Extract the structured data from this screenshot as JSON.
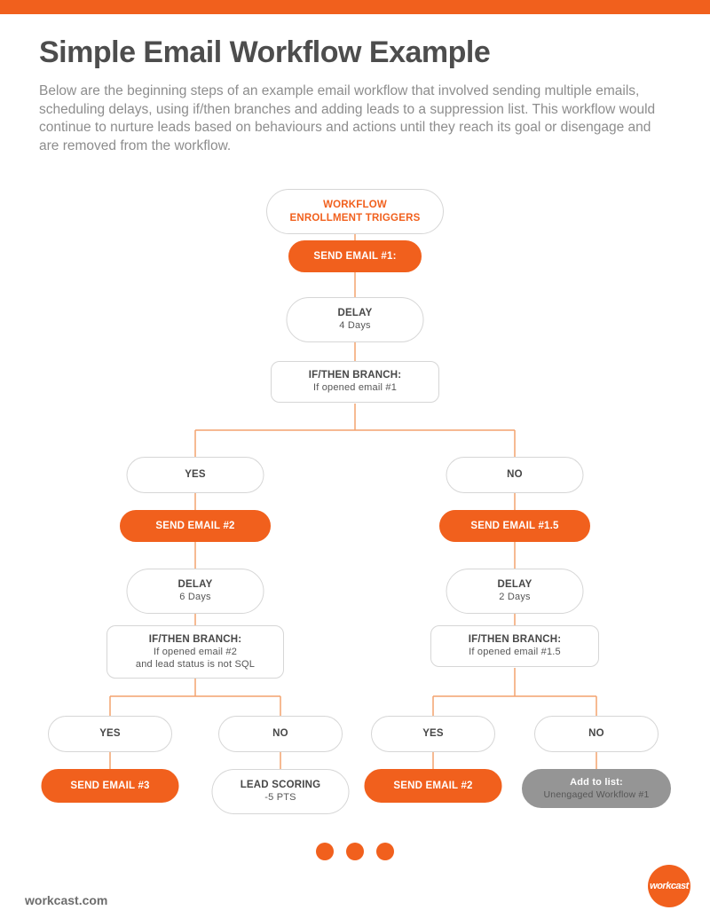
{
  "colors": {
    "accent": "#f1601d",
    "grey": "#959595"
  },
  "header": {
    "title": "Simple Email Workflow Example",
    "intro": "Below are the beginning steps of an example email workflow that involved sending multiple emails, scheduling delays, using if/then branches and adding leads to a suppression list. This workflow would continue to nurture leads based on behaviours and actions until they reach its goal or disengage and are removed from the workflow."
  },
  "nodes": {
    "enroll_l1": "WORKFLOW",
    "enroll_l2": "ENROLLMENT TRIGGERS",
    "send1": "SEND EMAIL #1:",
    "delay1_label": "DELAY",
    "delay1_value": "4 Days",
    "branch1_label": "IF/THEN BRANCH:",
    "branch1_cond": "If opened email #1",
    "yes": "YES",
    "no": "NO",
    "send2": "SEND EMAIL #2",
    "send15": "SEND EMAIL #1.5",
    "delay2_label": "DELAY",
    "delay2_value": "6 Days",
    "delay3_label": "DELAY",
    "delay3_value": "2 Days",
    "branch2_label": "IF/THEN BRANCH:",
    "branch2_cond1": "If opened email #2",
    "branch2_cond2": "and lead status is not SQL",
    "branch3_label": "IF/THEN BRANCH:",
    "branch3_cond": "If opened email #1.5",
    "send3": "SEND EMAIL #3",
    "leadscore_label": "LEAD SCORING",
    "leadscore_value": "-5 PTS",
    "send2b": "SEND EMAIL #2",
    "addlist_label": "Add to list:",
    "addlist_value": "Unengaged Workflow #1"
  },
  "footer": {
    "url": "workcast.com",
    "logo_text": "workcast"
  }
}
